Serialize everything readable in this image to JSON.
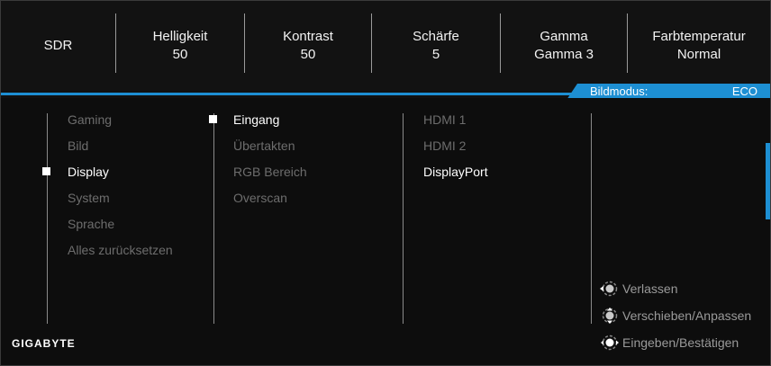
{
  "status": [
    {
      "label": "SDR",
      "value": ""
    },
    {
      "label": "Helligkeit",
      "value": "50"
    },
    {
      "label": "Kontrast",
      "value": "50"
    },
    {
      "label": "Schärfe",
      "value": "5"
    },
    {
      "label": "Gamma",
      "value": "Gamma 3"
    },
    {
      "label": "Farbtemperatur",
      "value": "Normal"
    }
  ],
  "mode": {
    "label": "Bildmodus:",
    "value": "ECO"
  },
  "menu": {
    "main": [
      "Gaming",
      "Bild",
      "Display",
      "System",
      "Sprache",
      "Alles zurücksetzen"
    ],
    "sub": [
      "Eingang",
      "Übertakten",
      "RGB Bereich",
      "Overscan"
    ],
    "options": [
      "HDMI 1",
      "HDMI 2",
      "DisplayPort"
    ]
  },
  "help": {
    "exit": "Verlassen",
    "move": "Verschieben/Anpassen",
    "enter": "Eingeben/Bestätigen"
  },
  "brand": "GIGABYTE",
  "colors": {
    "accent": "#1d8fd3",
    "inactive": "#6d6d6d",
    "active": "#ffffff"
  },
  "icons": [
    "joystick-left-icon",
    "joystick-updown-icon",
    "joystick-press-icon"
  ]
}
